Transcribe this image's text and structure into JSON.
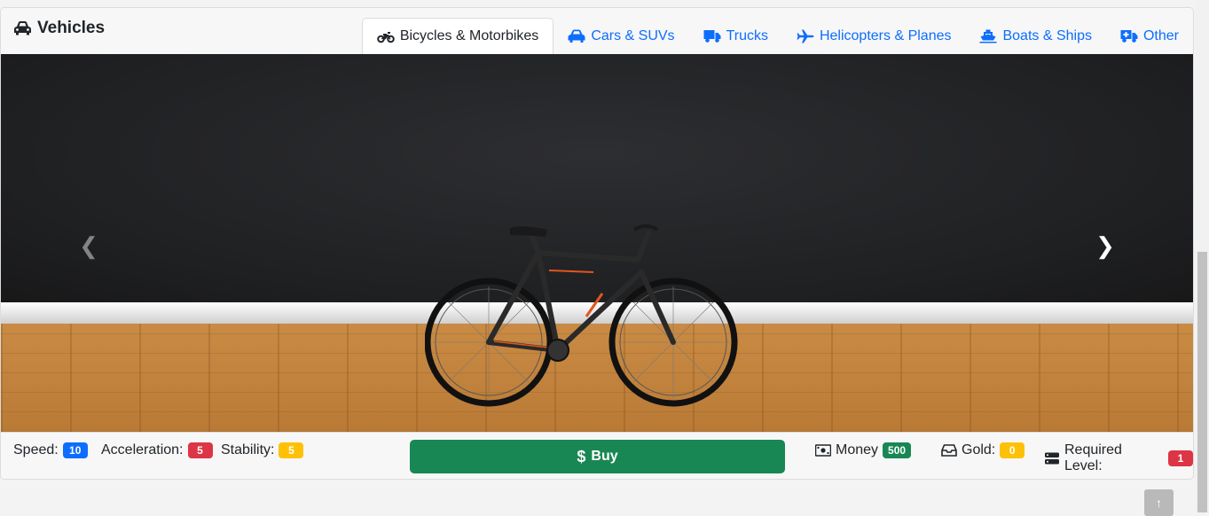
{
  "header": {
    "title": "Vehicles",
    "tabs": [
      {
        "label": "Bicycles & Motorbikes",
        "active": true
      },
      {
        "label": "Cars & SUVs"
      },
      {
        "label": "Trucks"
      },
      {
        "label": "Helicopters & Planes"
      },
      {
        "label": "Boats & Ships"
      },
      {
        "label": "Other"
      }
    ]
  },
  "carousel": {
    "prev_icon": "chevron-left-icon",
    "next_icon": "chevron-right-icon"
  },
  "stats": {
    "speed_label": "Speed:",
    "speed": "10",
    "acceleration_label": "Acceleration:",
    "acceleration": "5",
    "stability_label": "Stability:",
    "stability": "5"
  },
  "buy": {
    "label": "Buy",
    "icon": "dollar-icon"
  },
  "cost": {
    "money_label": "Money",
    "money": "500",
    "gold_label": "Gold:",
    "gold": "0",
    "level_label": "Required Level:",
    "level": "1"
  },
  "colors": {
    "accent": "#0d6efd",
    "buy": "#198754",
    "red": "#dc3545",
    "yellow": "#ffc107"
  }
}
